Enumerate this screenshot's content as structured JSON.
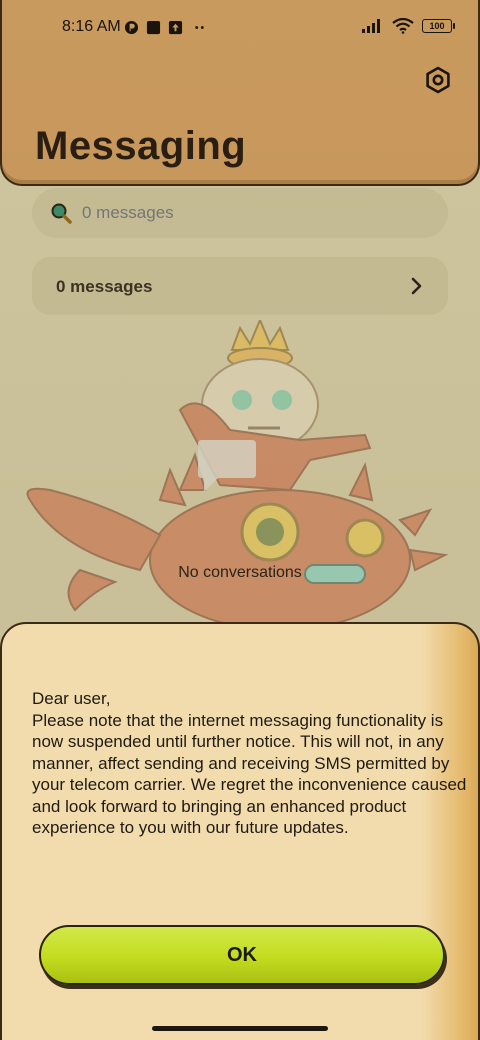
{
  "status_bar": {
    "time": "8:16 AM",
    "battery": "100"
  },
  "header": {
    "title": "Messaging",
    "settings_icon": "gear-icon"
  },
  "search": {
    "placeholder": "0 messages"
  },
  "messages_row": {
    "label": "0 messages"
  },
  "empty_state": {
    "text": "No conversations"
  },
  "dialog": {
    "message": "Dear user,\nPlease note that the internet messaging functionality is now suspended until further notice. This will not, in any manner, affect sending and receiving SMS permitted by your telecom carrier. We regret the inconvenience caused and look forward to bringing an enhanced product experience to you with our future updates.",
    "ok_label": "OK"
  },
  "colors": {
    "header_bg": "#c99a5e",
    "dialog_bg": "#f2dcae",
    "ok_button": "#c3dc1e"
  }
}
